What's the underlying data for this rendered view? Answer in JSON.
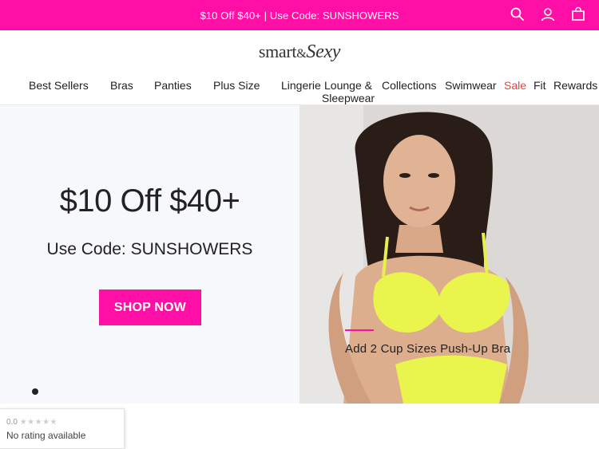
{
  "promo": {
    "text": "$10 Off $40+ | Use Code: SUNSHOWERS",
    "bg_color": "#ff0fa6"
  },
  "icons": {
    "search": "search-icon",
    "account": "user-icon",
    "bag": "shopping-bag-icon"
  },
  "logo": {
    "part1": "smart",
    "amp": "&",
    "part2": "Sexy"
  },
  "nav": {
    "items": [
      "Best Sellers",
      "Bras",
      "Panties",
      "Plus Size",
      "Lingerie",
      "Lounge & Sleepwear",
      "Collections",
      "Swimwear",
      "Sale",
      "Fit",
      "Rewards"
    ],
    "sale_color": "#e0453d"
  },
  "hero": {
    "headline": "$10 Off $40+",
    "subhead": "Use Code: SUNSHOWERS",
    "cta_label": "SHOP NOW",
    "caption": "Add 2 Cup Sizes Push-Up Bra",
    "accent_color": "#ff0fa6"
  },
  "rating": {
    "score": "0.0",
    "stars": "★★★★★",
    "text": "No rating available"
  }
}
